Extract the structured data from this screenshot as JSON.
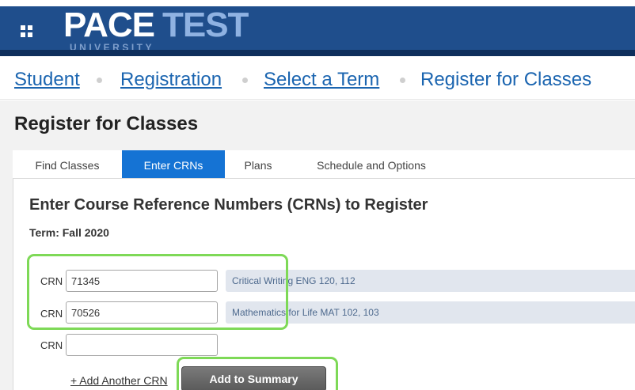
{
  "header": {
    "logo_main": "PACE",
    "logo_accent": "TEST",
    "logo_sub": "UNIVERSITY",
    "menu_icon": "grid-menu-icon"
  },
  "breadcrumb": [
    {
      "label": "Student",
      "link": true
    },
    {
      "label": "Registration",
      "link": true
    },
    {
      "label": "Select a Term",
      "link": true
    },
    {
      "label": "Register for Classes",
      "link": false
    }
  ],
  "page_title": "Register for Classes",
  "tabs": [
    {
      "label": "Find Classes",
      "active": false
    },
    {
      "label": "Enter CRNs",
      "active": true
    },
    {
      "label": "Plans",
      "active": false
    },
    {
      "label": "Schedule and Options",
      "active": false
    }
  ],
  "panel": {
    "title": "Enter Course Reference Numbers (CRNs) to Register",
    "term": "Term: Fall 2020",
    "crn_rows": [
      {
        "label": "CRN",
        "value": "71345",
        "course": "Critical Writing ENG 120, 112"
      },
      {
        "label": "CRN",
        "value": "70526",
        "course": "Mathematics for Life MAT 102, 103"
      },
      {
        "label": "CRN",
        "value": "",
        "course": ""
      }
    ],
    "add_another_label": "+ Add Another CRN",
    "add_to_summary_label": "Add to Summary"
  },
  "colors": {
    "header_bg": "#1f4e8c",
    "accent_blue": "#1573d4",
    "link_blue": "#1b65b0",
    "highlight_green": "#7ed957"
  }
}
